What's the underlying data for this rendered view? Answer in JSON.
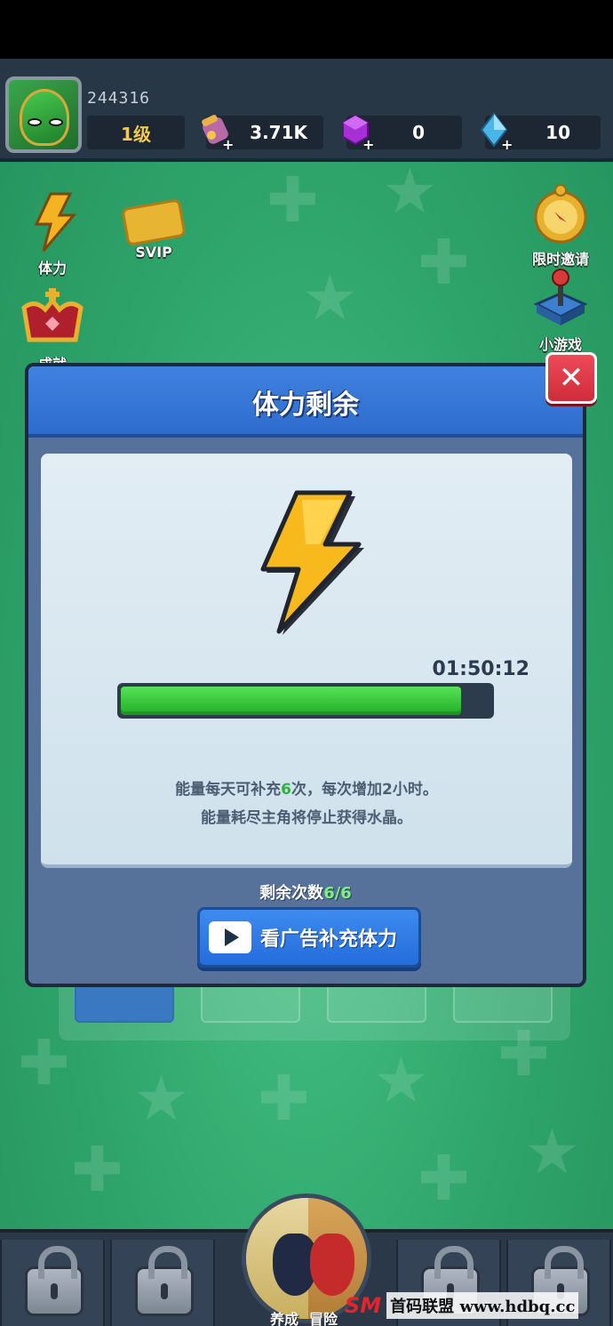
{
  "topbar": {
    "player_id": "244316",
    "level": "1级",
    "gold": "3.71K",
    "gems_purple": "0",
    "diamonds": "10"
  },
  "side_buttons": {
    "stamina": "体力",
    "svip": "SVIP",
    "achievement": "成就",
    "limited_invite": "限时邀请",
    "mini_game": "小游戏"
  },
  "dialog": {
    "title": "体力剩余",
    "timer": "01:50:12",
    "progress": 0.92,
    "desc_line1_a": "能量每天可补充",
    "desc_line1_b": "6",
    "desc_line1_c": "次，每次增加2小时。",
    "desc_line2": "能量耗尽主角将停止获得水晶。",
    "remain_label": "剩余次数",
    "remain_value": "6/6",
    "ad_button": "看广告补充体力",
    "close_symbol": "✕"
  },
  "bottomnav": {
    "train": "养成",
    "adventure": "冒险"
  },
  "watermark": {
    "logo": "SM",
    "text": "首码联盟 www.hdbq.cc"
  },
  "colors": {
    "accent_blue": "#2e6ccc",
    "progress_green": "#1fae24",
    "close_red": "#cf2b3b"
  }
}
